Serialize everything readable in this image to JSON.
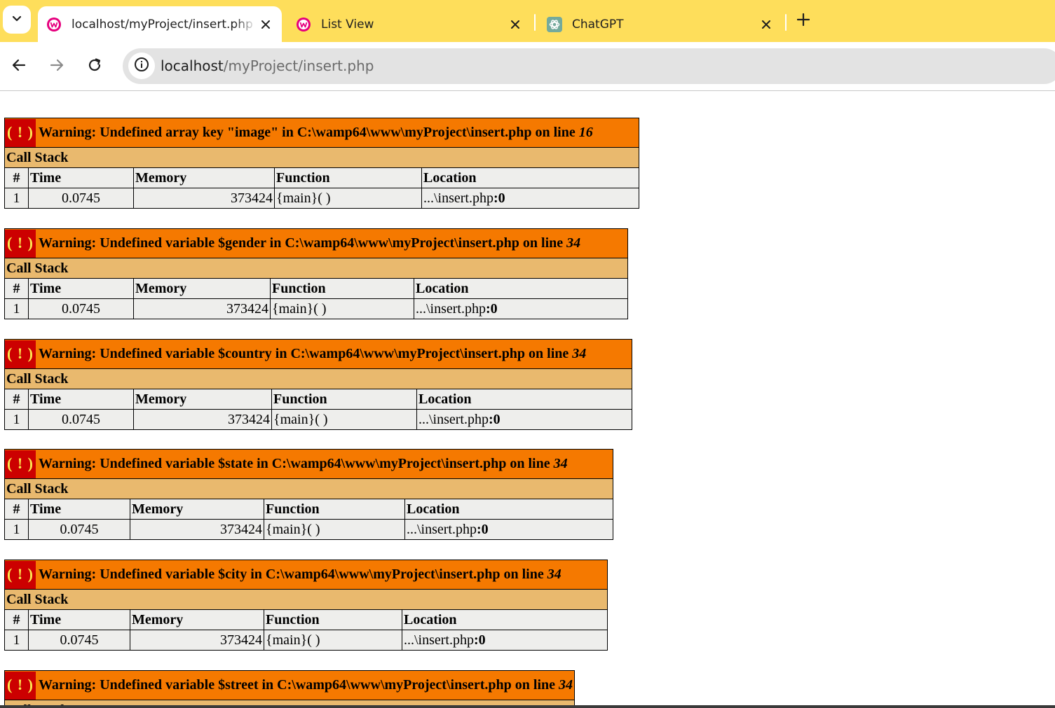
{
  "browser": {
    "tabs": [
      {
        "label": "localhost/myProject/insert.php",
        "active": true,
        "favicon": "wampserver-icon"
      },
      {
        "label": "List View",
        "active": false,
        "favicon": "wampserver-icon"
      },
      {
        "label": "ChatGPT",
        "active": false,
        "favicon": "chatgpt-icon"
      }
    ],
    "address": {
      "host": "localhost",
      "path": "/myProject/insert.php"
    },
    "colors": {
      "tabstrip": "#fede5b",
      "omnibox": "#e3e3e3"
    }
  },
  "colors": {
    "error_header": "#f57900",
    "error_icon_bg": "#cc0000",
    "error_icon_fg": "#fce94f",
    "callstack_header": "#e9b96e",
    "cell_bg": "#eeeeec"
  },
  "warnings": [
    {
      "icon": "( ! )",
      "message": "Warning: Undefined array key \"image\" in C:\\wamp64\\www\\myProject\\insert.php on line ",
      "line": "16"
    },
    {
      "icon": "( ! )",
      "message": "Warning: Undefined variable $gender in C:\\wamp64\\www\\myProject\\insert.php on line ",
      "line": "34"
    },
    {
      "icon": "( ! )",
      "message": "Warning: Undefined variable $country in C:\\wamp64\\www\\myProject\\insert.php on line ",
      "line": "34"
    },
    {
      "icon": "( ! )",
      "message": "Warning: Undefined variable $state in C:\\wamp64\\www\\myProject\\insert.php on line ",
      "line": "34"
    },
    {
      "icon": "( ! )",
      "message": "Warning: Undefined variable $city in C:\\wamp64\\www\\myProject\\insert.php on line ",
      "line": "34"
    },
    {
      "icon": "( ! )",
      "message": "Warning: Undefined variable $street in C:\\wamp64\\www\\myProject\\insert.php on line ",
      "line": "34"
    }
  ],
  "callstack": {
    "title": "Call Stack",
    "columns": [
      "#",
      "Time",
      "Memory",
      "Function",
      "Location"
    ],
    "row": {
      "num": "1",
      "time": "0.0745",
      "memory": "373424",
      "function": "{main}( )",
      "location_prefix": "...\\insert.php",
      "location_line": ":0"
    }
  }
}
